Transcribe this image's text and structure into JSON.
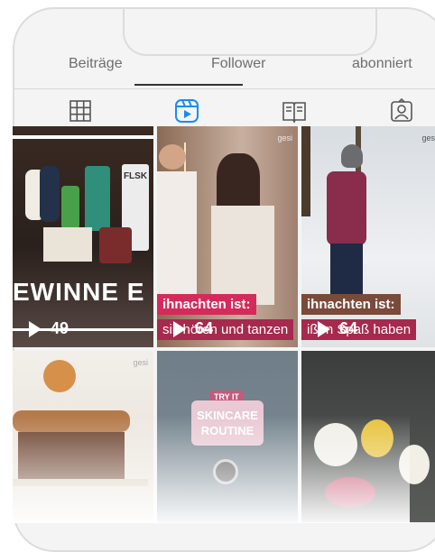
{
  "profile_tabs": [
    "Beiträge",
    "Follower",
    "abonniert"
  ],
  "content_tabs": [
    {
      "icon": "grid-icon",
      "active": false
    },
    {
      "icon": "reels-icon",
      "active": true
    },
    {
      "icon": "guide-book-icon",
      "active": false
    },
    {
      "icon": "tagged-person-icon",
      "active": false
    }
  ],
  "accent_color": "#1a8cf0",
  "grid": {
    "post1": {
      "overlay": "EWINNE E",
      "brand": "FLSK",
      "views": "49"
    },
    "post2": {
      "watermark": "gesi",
      "banner_top": "ihnachten ist:",
      "banner_bottom": "sik hören und tanzen",
      "views": "64"
    },
    "post3": {
      "watermark": "gesi",
      "banner_top": "ihnachten ist:",
      "banner_bottom": "ißen Spaß haben",
      "views": "64"
    },
    "post4": {
      "watermark": "gesi"
    },
    "post5": {
      "badge": "TRY IT",
      "title": "SKINCARE ROUTINE"
    },
    "post6": {}
  }
}
